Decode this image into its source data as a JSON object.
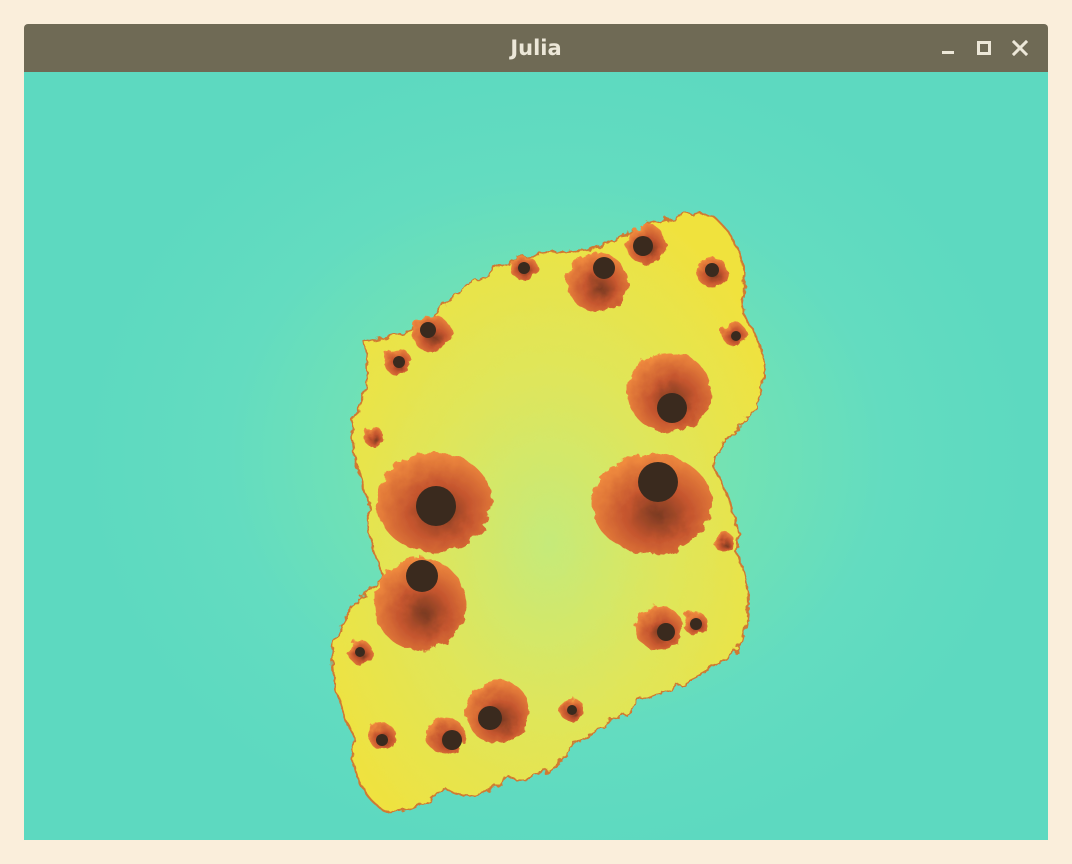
{
  "window": {
    "title": "Julia",
    "controls": {
      "minimize_icon": "minimize-icon",
      "maximize_icon": "maximize-icon",
      "close_icon": "close-icon"
    }
  },
  "colors": {
    "page_background": "#faeedb",
    "titlebar": "#6f6a55",
    "title_text": "#ece7d8",
    "canvas_teal": "#5dd9c0",
    "fractal_yellow": "#e7e64c",
    "fractal_orange": "#e2793a",
    "fractal_dark": "#3a2a1e"
  }
}
